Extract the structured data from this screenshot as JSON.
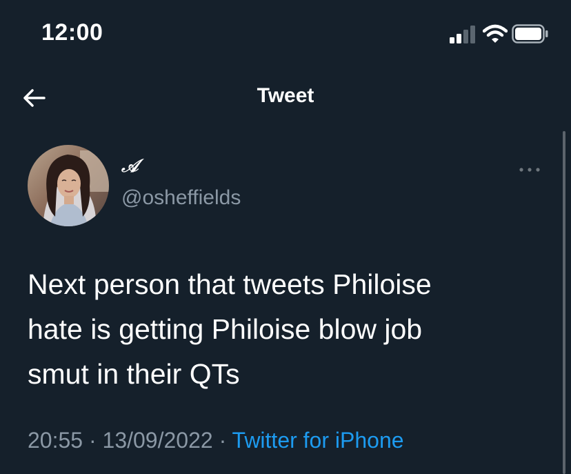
{
  "status_bar": {
    "time": "12:00",
    "icons": [
      "signal-icon",
      "wifi-icon",
      "battery-icon"
    ]
  },
  "nav": {
    "title": "Tweet",
    "back_icon": "arrow-left-icon"
  },
  "tweet": {
    "display_name": "𝒜",
    "handle": "@osheffields",
    "text_lines": [
      "Next person that tweets Philoise",
      "hate is getting Philoise blow job",
      "smut in their QTs"
    ],
    "time": "20:55",
    "separator": "·",
    "date": "13/09/2022",
    "source": "Twitter for iPhone",
    "more_icon": "more-horizontal-icon"
  },
  "colors": {
    "background": "#15202b",
    "text": "#ffffff",
    "secondary_text": "#8b98a5",
    "accent": "#1d9bf0"
  }
}
